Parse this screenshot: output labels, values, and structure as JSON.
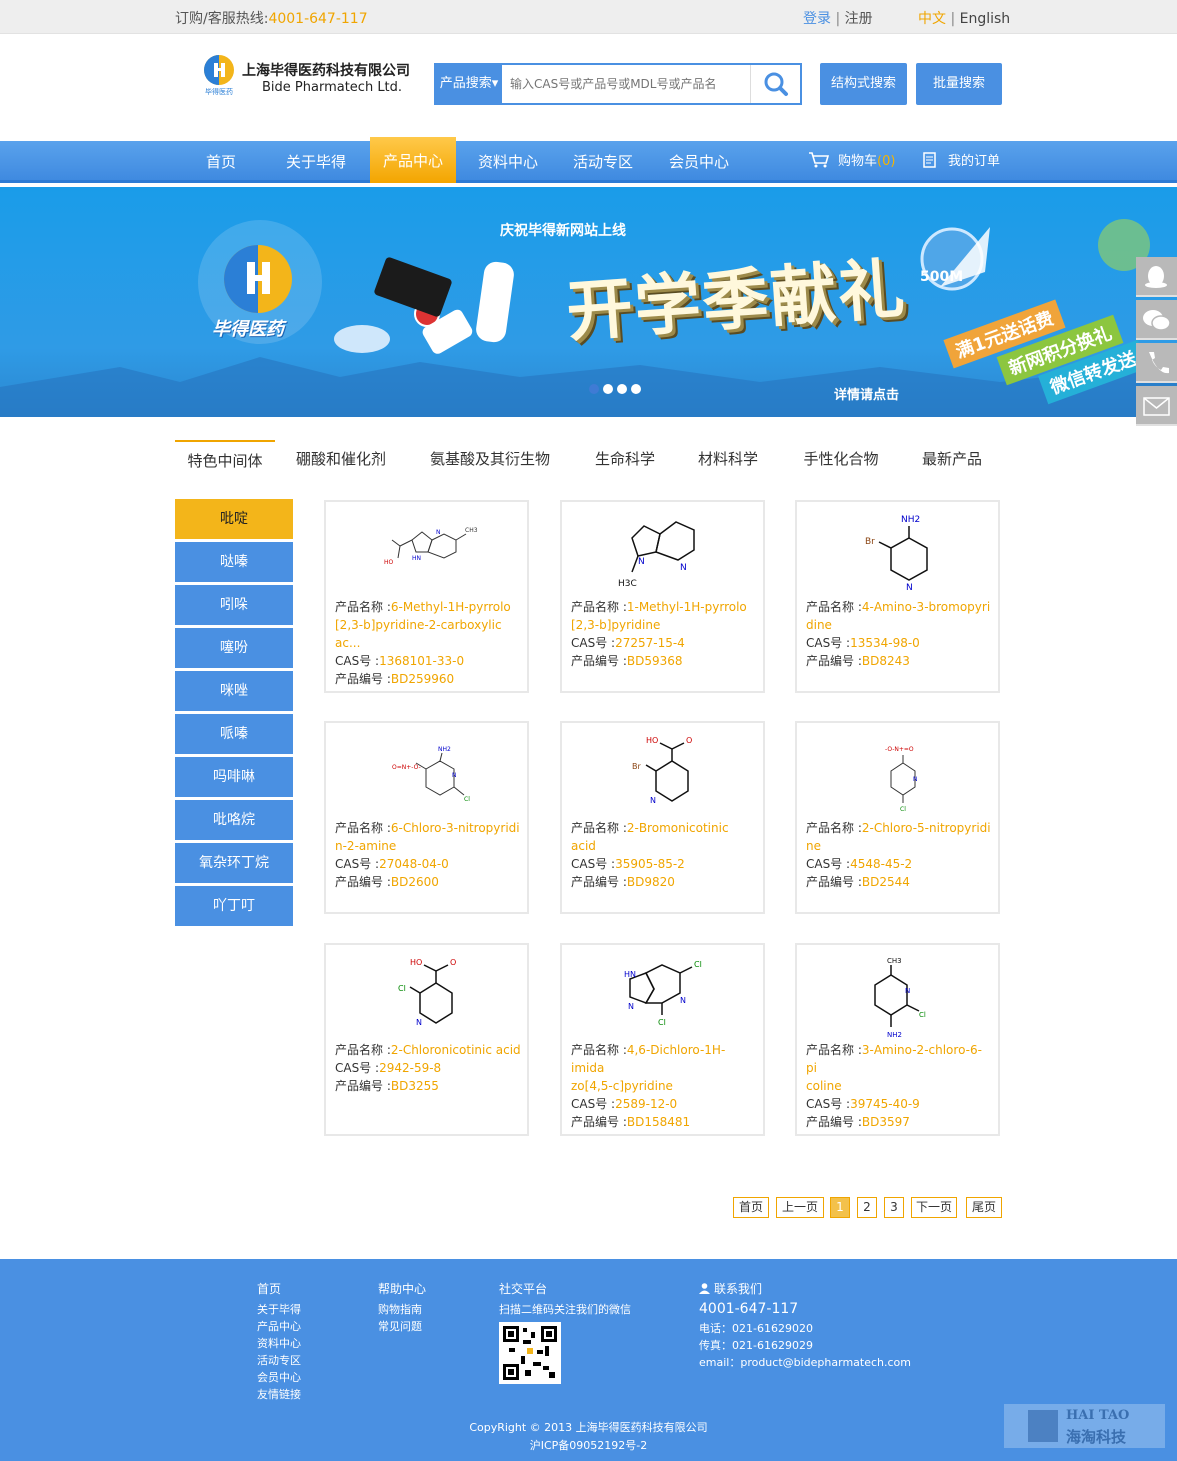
{
  "topbar": {
    "hotline_label": "订购/客服热线:",
    "hotline_number": "4001-647-117",
    "login": "登录",
    "separator": "|",
    "register": "注册",
    "lang_cn": "中文",
    "lang_en": "English"
  },
  "header": {
    "company_cn": "上海毕得医药科技有限公司",
    "company_en": "Bide Pharmatech Ltd.",
    "logo_sub": "毕得医药",
    "search_category": "产品搜索▾",
    "search_placeholder": "输入CAS号或产品号或MDL号或产品名",
    "structure_search": "结构式搜索",
    "batch_search": "批量搜索"
  },
  "nav": {
    "items": [
      "首页",
      "关于毕得",
      "产品中心",
      "资料中心",
      "活动专区",
      "会员中心"
    ],
    "active_index": 2,
    "cart_label": "购物车",
    "cart_count": "(0)",
    "orders_label": "我的订单"
  },
  "banner": {
    "headline": "庆祝毕得新网站上线",
    "main_text": "开学季献礼",
    "brand_cn": "毕得医药",
    "badge": "500M",
    "strip1": "满1元送话费",
    "strip2": "新网积分换礼",
    "strip3": "微信转发送",
    "more": "详情请点击",
    "slides": 4,
    "active_slide": 0
  },
  "category_tabs": [
    "特色中间体",
    "硼酸和催化剂",
    "氨基酸及其衍生物",
    "生命科学",
    "材料科学",
    "手性化合物",
    "最新产品"
  ],
  "side_menu": [
    "吡啶",
    "哒嗪",
    "吲哚",
    "噻吩",
    "咪唑",
    "哌嗪",
    "吗啡啉",
    "吡咯烷",
    "氧杂环丁烷",
    "吖丁叮"
  ],
  "labels": {
    "name": "产品名称 :",
    "cas": "CAS号 :",
    "code": "产品编号 :"
  },
  "products": [
    {
      "name1": "6-Methyl-1H-pyrrolo",
      "name2": "[2,3-b]pyridine-2-carboxylic ac...",
      "cas": "1368101-33-0",
      "code": "BD259960"
    },
    {
      "name1": "1-Methyl-1H-pyrrolo",
      "name2": "[2,3-b]pyridine",
      "cas": "27257-15-4",
      "code": "BD59368"
    },
    {
      "name1": "4-Amino-3-bromopyri",
      "name2": "dine",
      "cas": "13534-98-0",
      "code": "BD8243"
    },
    {
      "name1": "6-Chloro-3-nitropyridi",
      "name2": "n-2-amine",
      "cas": "27048-04-0",
      "code": "BD2600"
    },
    {
      "name1": "2-Bromonicotinic acid",
      "name2": "",
      "cas": "35905-85-2",
      "code": "BD9820"
    },
    {
      "name1": "2-Chloro-5-nitropyridi",
      "name2": "ne",
      "cas": "4548-45-2",
      "code": "BD2544"
    },
    {
      "name1": "2-Chloronicotinic acid",
      "name2": "",
      "cas": "2942-59-8",
      "code": "BD3255"
    },
    {
      "name1": "4,6-Dichloro-1H-imida",
      "name2": "zo[4,5-c]pyridine",
      "cas": "2589-12-0",
      "code": "BD158481"
    },
    {
      "name1": "3-Amino-2-chloro-6-pi",
      "name2": "coline",
      "cas": "39745-40-9",
      "code": "BD3597"
    }
  ],
  "mol_labels": {
    "m0_ch3": "CH3",
    "m0_ho": "HO",
    "m0_nh": "HN",
    "m0_n": "N",
    "m1_n": "N",
    "m1_n2": "N",
    "m1_h3c": "H3C",
    "m2_nh2": "NH2",
    "m2_br": "Br",
    "m2_n": "N",
    "m3_nh2": "NH2",
    "m3_no2": "O=N+-O-",
    "m3_n": "N",
    "m3_cl": "Cl",
    "m4_ho": "HO",
    "m4_o": "O",
    "m4_br": "Br",
    "m4_n": "N",
    "m5_no2": "-O-N+=O",
    "m5_n": "N",
    "m5_cl": "Cl",
    "m6_ho": "HO",
    "m6_o": "O",
    "m6_cl": "Cl",
    "m6_n": "N",
    "m7_hn": "HN",
    "m7_n": "N",
    "m7_n2": "N",
    "m7_cl": "Cl",
    "m7_cl2": "Cl",
    "m8_ch3": "CH3",
    "m8_n": "N",
    "m8_cl": "Cl",
    "m8_nh2": "NH2"
  },
  "pagination": {
    "first": "首页",
    "prev": "上一页",
    "pages": [
      "1",
      "2",
      "3"
    ],
    "current": "1",
    "next": "下一页",
    "last": "尾页"
  },
  "footer": {
    "col1": [
      "首页",
      "关于毕得",
      "产品中心",
      "资料中心",
      "活动专区",
      "会员中心",
      "友情链接"
    ],
    "col2_title": "帮助中心",
    "col2": [
      "购物指南",
      "常见问题"
    ],
    "col3_title": "社交平台",
    "col3_text": "扫描二维码关注我们的微信",
    "col4_title": "联系我们",
    "phone": "4001-647-117",
    "tel": "电话：021-61629020",
    "fax": "传真：021-61629029",
    "email": "email：product@bidepharmatech.com",
    "copyright": "CopyRight © 2013 上海毕得医药科技有限公司",
    "icp": "沪ICP备09052192号-2",
    "watermark_en": "HAI TAO",
    "watermark_cn": "海淘科技"
  },
  "colors": {
    "accent": "#f0a500",
    "primary": "#4a90e2",
    "footer": "#4a90e2"
  }
}
